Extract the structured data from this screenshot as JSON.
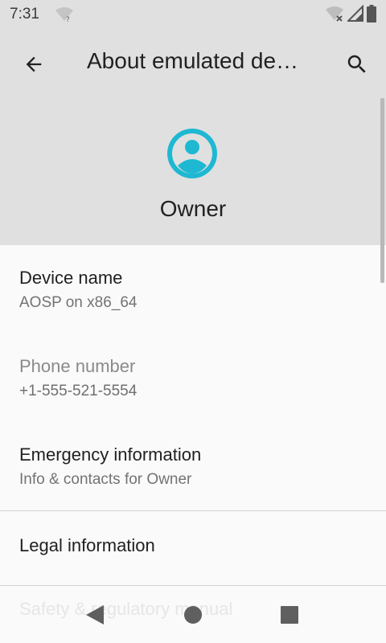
{
  "status_bar": {
    "time": "7:31"
  },
  "app_bar": {
    "title": "About emulated de…"
  },
  "header": {
    "owner_name": "Owner"
  },
  "preferences": [
    {
      "title": "Device name",
      "summary": "AOSP on x86_64"
    },
    {
      "title": "Phone number",
      "summary": "+1-555-521-5554"
    },
    {
      "title": "Emergency information",
      "summary": "Info & contacts for Owner"
    },
    {
      "title": "Legal information"
    }
  ],
  "partially_visible_item": "Safety & regulatory manual",
  "icons": {
    "back": "arrow-back-icon",
    "search": "search-icon",
    "avatar": "account-circle-icon",
    "nav_back": "triangle-back-icon",
    "nav_home": "circle-home-icon",
    "nav_recents": "square-recents-icon"
  },
  "colors": {
    "app_bar_bg": "#e0e0e0",
    "content_bg": "#fafafa",
    "accent": "#1eb8d2"
  }
}
